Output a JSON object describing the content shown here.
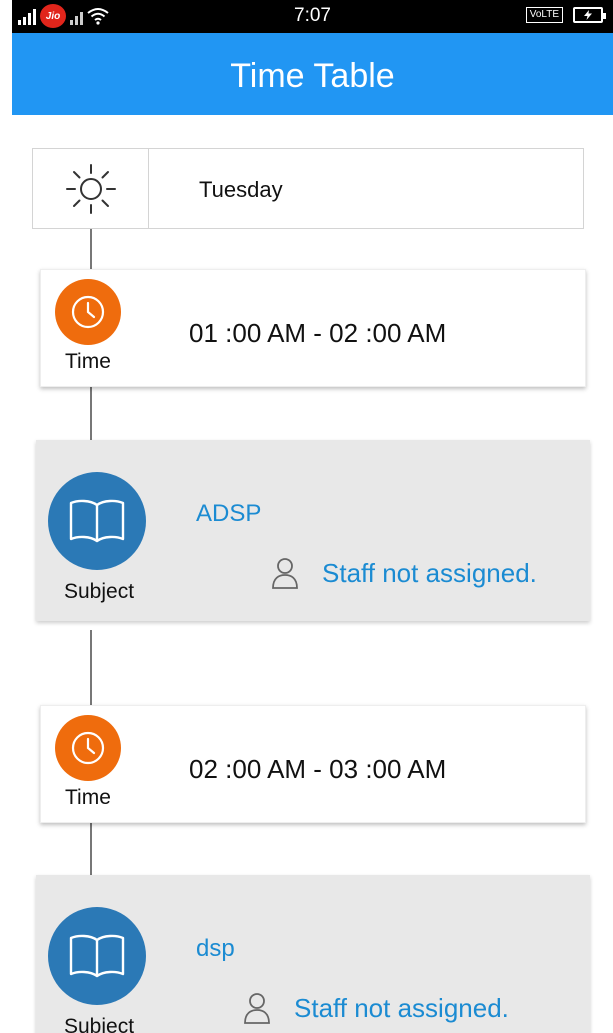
{
  "status_bar": {
    "time": "7:07",
    "carrier": "Jio",
    "network_badge": "VoLTE",
    "icons": [
      "signal-icon",
      "jio-icon",
      "signal-icon",
      "wifi-icon",
      "volte-icon",
      "battery-charging-icon"
    ]
  },
  "app_bar": {
    "title": "Time Table"
  },
  "day": {
    "icon": "sun-icon",
    "label": "Tuesday"
  },
  "entries": [
    {
      "time": {
        "icon": "clock-icon",
        "caption": "Time",
        "range": "01 :00  AM - 02 :00  AM"
      },
      "subject": {
        "icon": "book-icon",
        "caption": "Subject",
        "name": "ADSP",
        "staff_icon": "person-icon",
        "staff": "Staff not assigned."
      }
    },
    {
      "time": {
        "icon": "clock-icon",
        "caption": "Time",
        "range": "02 :00  AM - 03 :00  AM"
      },
      "subject": {
        "icon": "book-icon",
        "caption": "Subject",
        "name": "dsp",
        "staff_icon": "person-icon",
        "staff": "Staff not assigned."
      }
    }
  ],
  "colors": {
    "app_bar": "#2196f3",
    "clock_badge": "#ef6c0d",
    "book_badge": "#2b79b6",
    "link_text": "#1b8bd2",
    "subject_card": "#e8e8e8"
  }
}
